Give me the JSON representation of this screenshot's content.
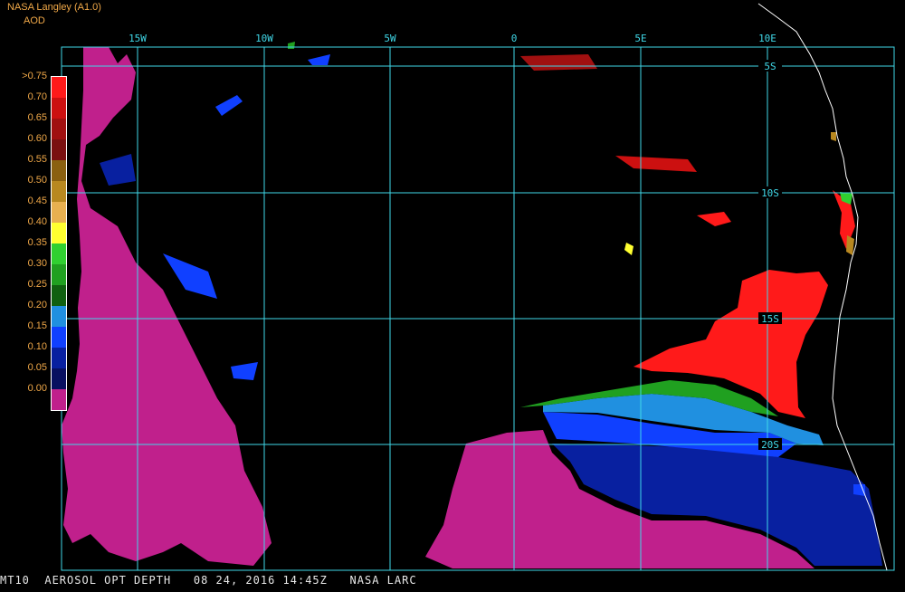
{
  "header": {
    "line1": "NASA Langley (A1.0)",
    "line2": "AOD"
  },
  "legend": {
    "labels": [
      ">0.75",
      "0.70",
      "0.65",
      "0.60",
      "0.55",
      "0.50",
      "0.45",
      "0.40",
      "0.35",
      "0.30",
      "0.25",
      "0.20",
      "0.15",
      "0.10",
      "0.05",
      "0.00"
    ],
    "colors": [
      "#ff1a1a",
      "#cc1010",
      "#a01010",
      "#7a1010",
      "#8a6010",
      "#b88820",
      "#e8b050",
      "#ffff30",
      "#30d030",
      "#20a020",
      "#106010",
      "#2090e0",
      "#1040ff",
      "#0820a0",
      "#081060",
      "#c0208c"
    ]
  },
  "grid": {
    "lon_labels": [
      "15W",
      "10W",
      "5W",
      "0",
      "5E",
      "10E"
    ],
    "lat_labels": [
      "5S",
      "10S",
      "15S",
      "20S"
    ]
  },
  "footer": "MT10  AEROSOL OPT DEPTH   08 24, 2016 14:45Z   NASA LARC",
  "colors": {
    "grid": "#40d8e8",
    "coast": "#ffffff",
    "frame": "#40d8e8"
  }
}
